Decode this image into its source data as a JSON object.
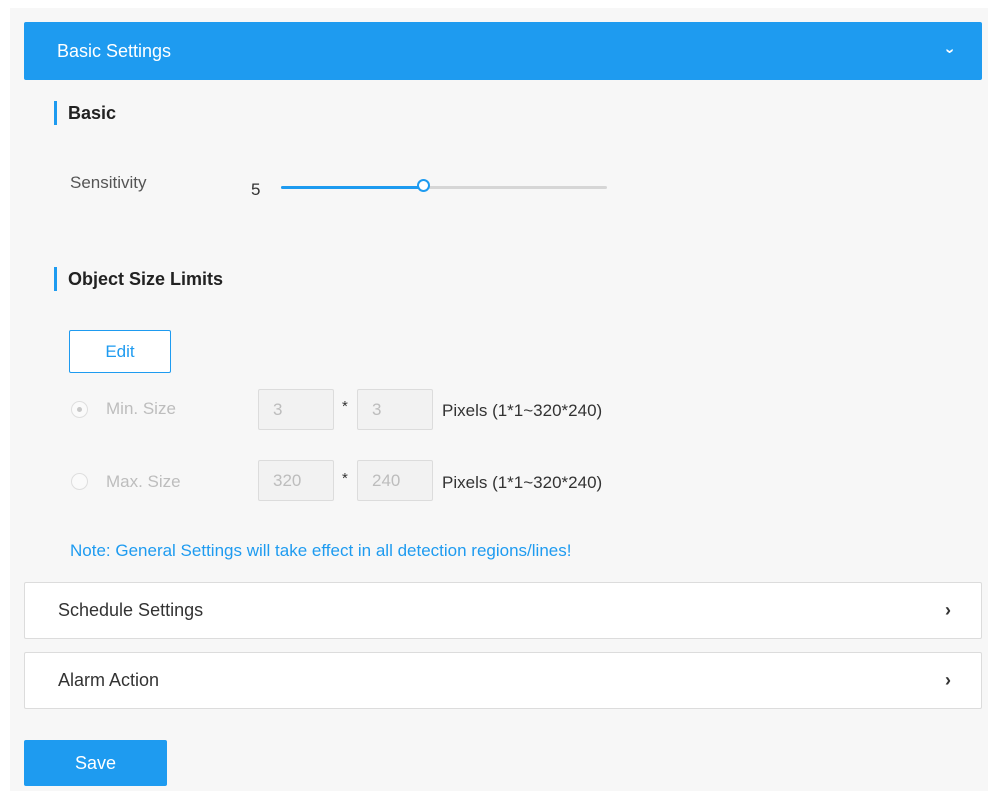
{
  "accordions": {
    "basic_settings": {
      "label": "Basic Settings",
      "expanded": true
    },
    "schedule_settings": {
      "label": "Schedule Settings",
      "expanded": false
    },
    "alarm_action": {
      "label": "Alarm Action",
      "expanded": false
    }
  },
  "basic": {
    "title": "Basic",
    "sensitivity": {
      "label": "Sensitivity",
      "value": "5",
      "level": 0.44
    }
  },
  "object_size": {
    "title": "Object Size Limits",
    "edit_label": "Edit",
    "min": {
      "label": "Min. Size",
      "width": "3",
      "height": "3",
      "separator": "*",
      "range": "Pixels (1*1~320*240)",
      "selected": true
    },
    "max": {
      "label": "Max. Size",
      "width": "320",
      "height": "240",
      "separator": "*",
      "range": "Pixels (1*1~320*240)",
      "selected": false
    }
  },
  "note": "Note: General Settings will take effect in all detection regions/lines!",
  "save_label": "Save",
  "icons": {
    "expand": "chevron-down-icon",
    "collapse": "chevron-right-icon"
  },
  "colors": {
    "accent": "#1e9bf0"
  }
}
